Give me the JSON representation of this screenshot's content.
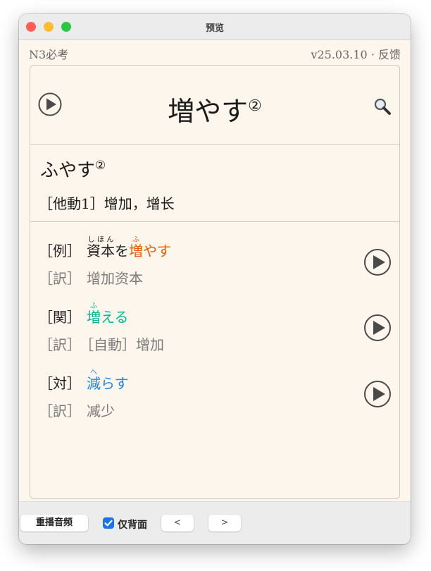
{
  "window": {
    "title": "预览"
  },
  "header": {
    "level": "N3必考",
    "version": "v25.03.10 · 反馈"
  },
  "entry": {
    "word": "増やす",
    "accent": "②",
    "reading": "ふやす",
    "reading_accent": "②",
    "pos": "［他動1］",
    "meaning": "增加，增长"
  },
  "examples": [
    {
      "tag": "［例］",
      "ruby_base": "資本",
      "ruby_text": "しほん",
      "particle": "を",
      "hl_ruby_base": "増",
      "hl_ruby_text": "ふ",
      "hl_tail": "やす",
      "trans_tag": "［訳］",
      "trans": "增加资本"
    },
    {
      "tag": "［関］",
      "hl_ruby_base": "増",
      "hl_ruby_text": "ふ",
      "hl_tail": "える",
      "trans_tag": "［訳］",
      "trans": "［自動］增加"
    },
    {
      "tag": "［対］",
      "hl_ruby_base": "減",
      "hl_ruby_text": "へ",
      "hl_tail": "らす",
      "trans_tag": "［訳］",
      "trans": "减少"
    }
  ],
  "toolbar": {
    "replay": "重播音频",
    "back_only": "仅背面",
    "back_only_checked": true,
    "prev": "<",
    "next": ">"
  },
  "icons": {
    "play": "play-circle-icon",
    "search": "magnifier-icon",
    "checkbox": "checkmark-icon"
  },
  "colors": {
    "example_highlight": "#f05a00",
    "related_highlight": "#00b894",
    "antonym_highlight": "#1e88e5",
    "card_background": "#fdf6ec"
  }
}
